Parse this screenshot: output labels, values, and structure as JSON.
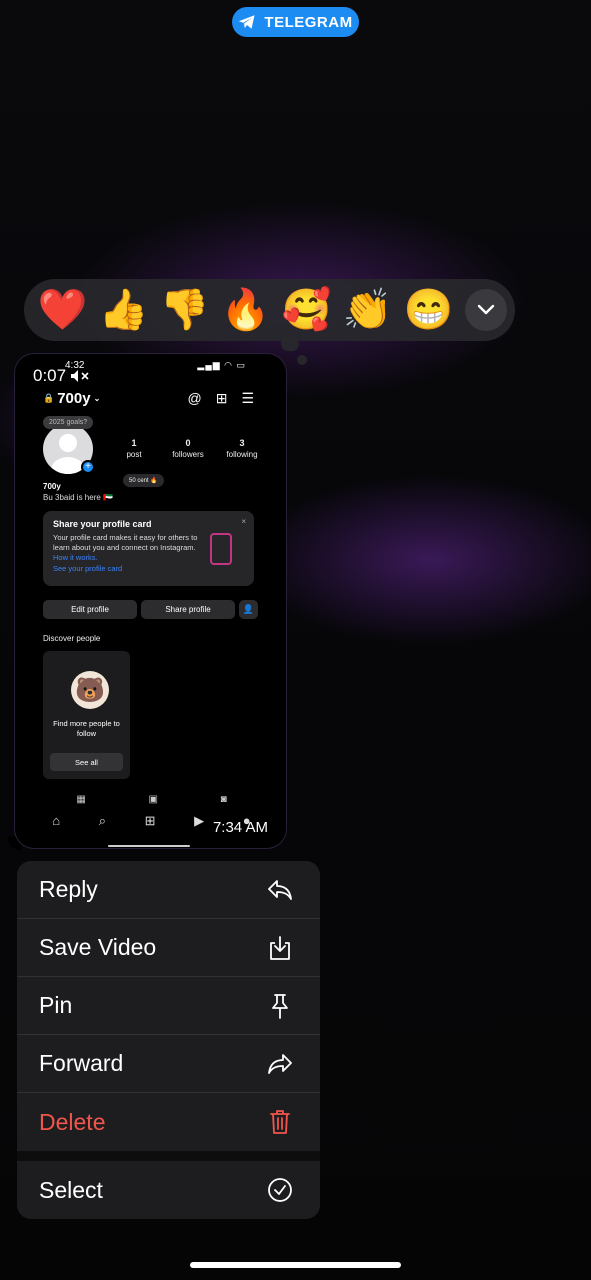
{
  "header": {
    "badge": "TELEGRAM"
  },
  "reactions": [
    {
      "emoji": "❤️",
      "name": "heart"
    },
    {
      "emoji": "👍",
      "name": "thumbs-up"
    },
    {
      "emoji": "👎",
      "name": "thumbs-down"
    },
    {
      "emoji": "🔥",
      "name": "fire"
    },
    {
      "emoji": "🥰",
      "name": "smiling-hearts"
    },
    {
      "emoji": "👏",
      "name": "clapping"
    },
    {
      "emoji": "😁",
      "name": "grinning"
    }
  ],
  "video": {
    "status_time": "4:32",
    "elapsed": "0:07",
    "sent_time": "7:34 AM",
    "profile": {
      "username": "700y",
      "note": "2025 goals?",
      "stats": [
        {
          "value": "1",
          "label": "post"
        },
        {
          "value": "0",
          "label": "followers"
        },
        {
          "value": "3",
          "label": "following"
        }
      ],
      "name": "700y",
      "bio": "Bu 3baid is here 🇦🇪",
      "music": "50 cent 🔥",
      "card": {
        "title": "Share your profile card",
        "body": "Your profile card makes it easy for others to learn about you and connect on Instagram.",
        "link": "How it works.",
        "cta": "See your profile card"
      },
      "buttons": {
        "edit": "Edit profile",
        "share": "Share profile"
      },
      "discover_label": "Discover people",
      "suggest_text": "Find more people to follow",
      "see_all": "See all"
    }
  },
  "menu": {
    "items": [
      {
        "label": "Reply",
        "icon": "reply-icon"
      },
      {
        "label": "Save Video",
        "icon": "save-icon"
      },
      {
        "label": "Pin",
        "icon": "pin-icon"
      },
      {
        "label": "Forward",
        "icon": "forward-icon"
      },
      {
        "label": "Delete",
        "icon": "trash-icon"
      },
      {
        "label": "Select",
        "icon": "check-circle-icon"
      }
    ]
  }
}
